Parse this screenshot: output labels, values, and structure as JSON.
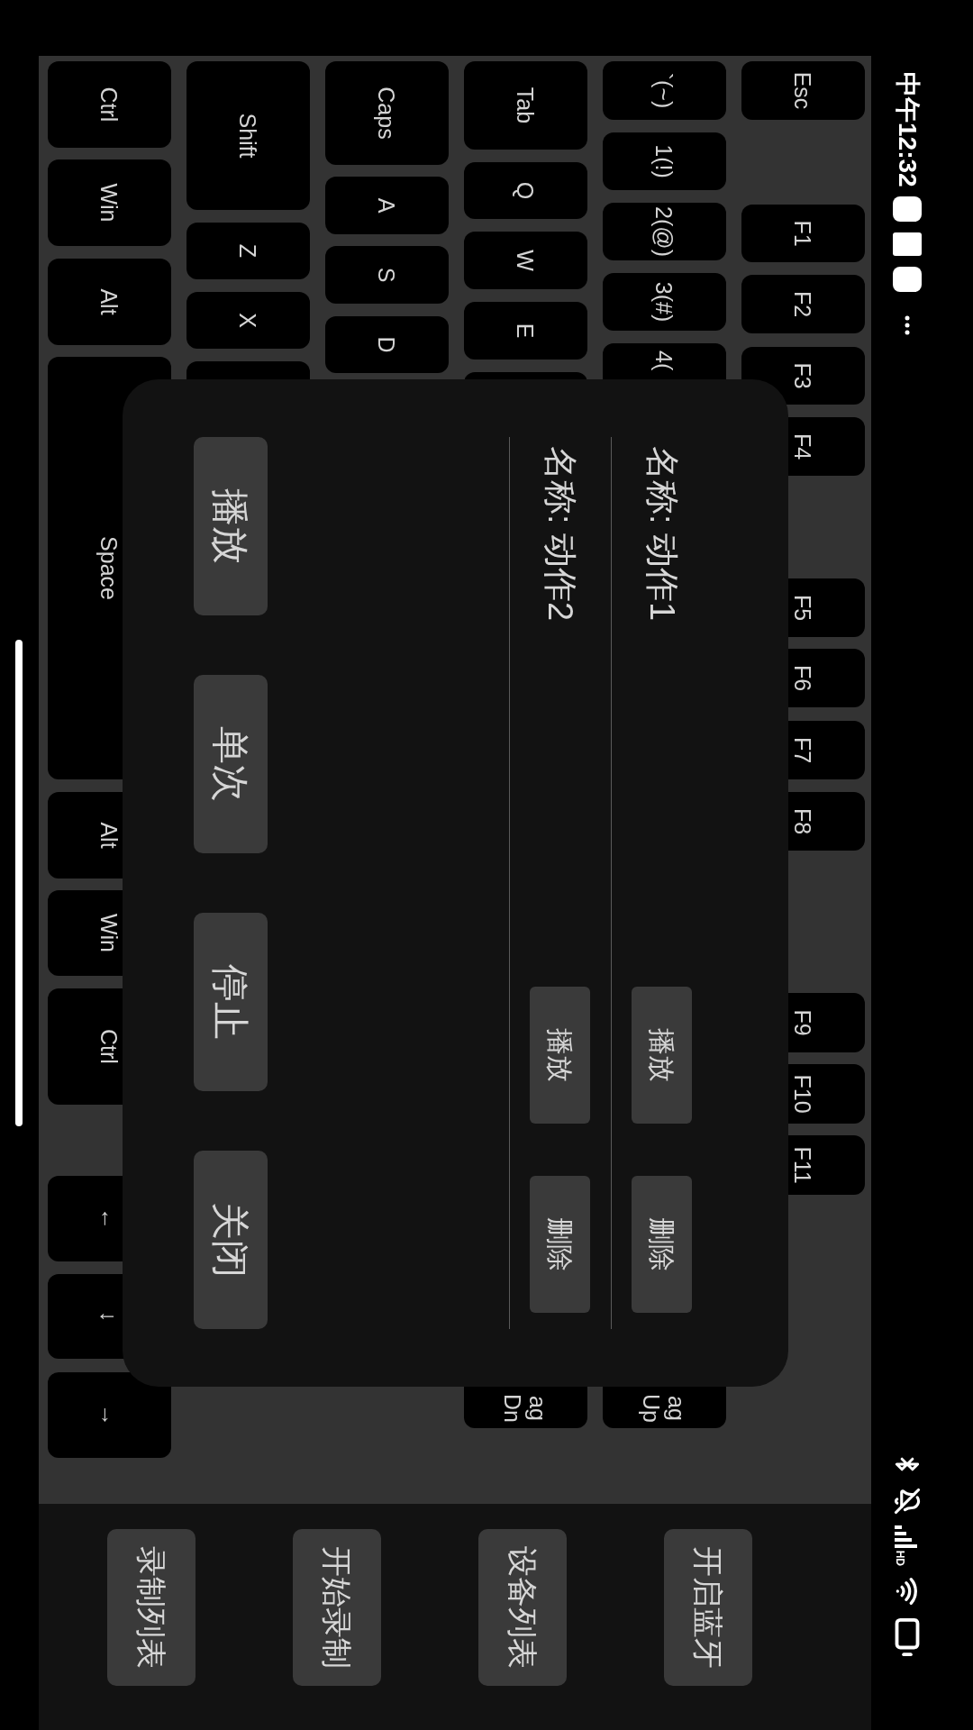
{
  "status_bar": {
    "time": "中午12:32",
    "network_label": "HD"
  },
  "keyboard": {
    "rows": [
      {
        "keys": [
          {
            "label": "Esc"
          },
          {
            "label": "F1"
          },
          {
            "label": "F2"
          },
          {
            "label": "F3"
          },
          {
            "label": "F4"
          },
          {
            "label": "F5"
          },
          {
            "label": "F6"
          },
          {
            "label": "F7"
          },
          {
            "label": "F8"
          },
          {
            "label": "F9"
          },
          {
            "label": "F10"
          },
          {
            "label": "F11"
          }
        ]
      },
      {
        "keys": [
          {
            "label": "`(~)"
          },
          {
            "label": "1(!)"
          },
          {
            "label": "2(@)"
          },
          {
            "label": "3(#)"
          },
          {
            "label": "4("
          },
          {
            "label": "ag\nUp"
          }
        ]
      },
      {
        "keys": [
          {
            "label": "Tab"
          },
          {
            "label": "Q"
          },
          {
            "label": "W"
          },
          {
            "label": "E"
          },
          {
            "label": "ag\nDn"
          }
        ]
      },
      {
        "keys": [
          {
            "label": "Caps"
          },
          {
            "label": "A"
          },
          {
            "label": "S"
          },
          {
            "label": "D"
          }
        ]
      },
      {
        "keys": [
          {
            "label": "Shift"
          },
          {
            "label": "Z"
          },
          {
            "label": "X"
          }
        ]
      },
      {
        "keys": [
          {
            "label": "Ctrl"
          },
          {
            "label": "Win"
          },
          {
            "label": "Alt"
          },
          {
            "label": "Space"
          },
          {
            "label": "Alt"
          },
          {
            "label": "Win"
          },
          {
            "label": "Ctrl"
          },
          {
            "label": "←"
          },
          {
            "label": "↓"
          },
          {
            "label": "→"
          }
        ]
      }
    ]
  },
  "dialog": {
    "recordings": [
      {
        "name": "名称: 动作1",
        "buttons": [
          "播放",
          "删除"
        ]
      },
      {
        "name": "名称: 动作2",
        "buttons": [
          "播放",
          "删除"
        ]
      }
    ],
    "buttons": [
      "播放",
      "单次",
      "停止",
      "关闭"
    ]
  },
  "side_buttons": [
    "开启蓝牙",
    "设备列表",
    "开始录制",
    "录制列表"
  ]
}
